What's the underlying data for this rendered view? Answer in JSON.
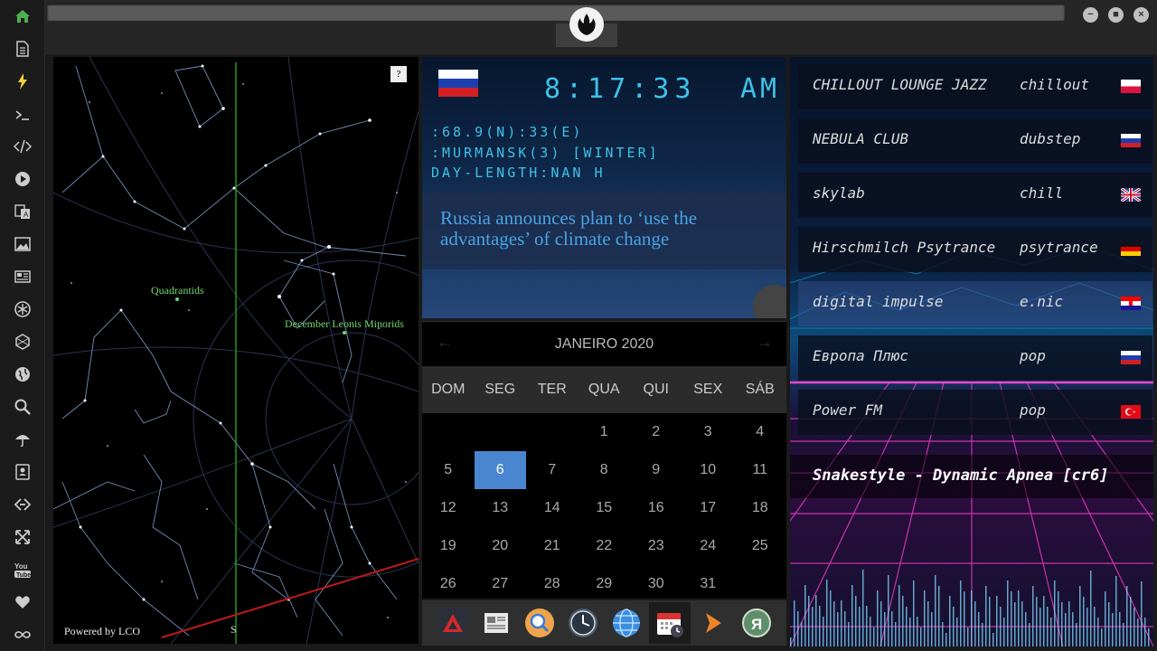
{
  "sidebar": {
    "items": [
      {
        "name": "home-icon"
      },
      {
        "name": "document-icon"
      },
      {
        "name": "lightning-icon"
      },
      {
        "name": "terminal-icon"
      },
      {
        "name": "code-icon"
      },
      {
        "name": "play-icon"
      },
      {
        "name": "translate-icon"
      },
      {
        "name": "image-icon"
      },
      {
        "name": "news-icon"
      },
      {
        "name": "rebel-alliance-icon"
      },
      {
        "name": "hexagon-icon"
      },
      {
        "name": "globe-icon"
      },
      {
        "name": "search-icon"
      },
      {
        "name": "umbrella-icon"
      },
      {
        "name": "contact-card-icon"
      },
      {
        "name": "link-icon"
      },
      {
        "name": "expand-icon"
      },
      {
        "name": "youtube-icon"
      },
      {
        "name": "heart-icon"
      },
      {
        "name": "infinity-icon"
      }
    ],
    "accent": "#4caf50"
  },
  "window": {
    "minimize": "−",
    "maximize": "■",
    "close": "×"
  },
  "skymap": {
    "help": "?",
    "powered_by": "Powered by LCO",
    "direction": "S",
    "meteors": [
      {
        "label": "Quadrantids"
      },
      {
        "label": "December Leonis Minorids"
      }
    ]
  },
  "clock": {
    "time": "8:17:33",
    "ampm": "AM",
    "coords": ":68.9(N):33(E)",
    "location": ":MURMANSK(3) [WINTER]",
    "day_length": "DAY-LENGTH:NAN H",
    "color": "#3fc1e8"
  },
  "news": {
    "headline": "Russia announces plan to ‘use the advantages’ of climate change"
  },
  "calendar": {
    "month": "JANEIRO 2020",
    "prev": "←",
    "next": "→",
    "weekdays": [
      "DOM",
      "SEG",
      "TER",
      "QUA",
      "QUI",
      "SEX",
      "SÁB"
    ],
    "weeks": [
      [
        "",
        "",
        "",
        "1",
        "2",
        "3",
        "4"
      ],
      [
        "5",
        "6",
        "7",
        "8",
        "9",
        "10",
        "11"
      ],
      [
        "12",
        "13",
        "14",
        "15",
        "16",
        "17",
        "18"
      ],
      [
        "19",
        "20",
        "21",
        "22",
        "23",
        "24",
        "25"
      ],
      [
        "26",
        "27",
        "28",
        "29",
        "30",
        "31",
        ""
      ]
    ],
    "today": "6",
    "today_color": "#4a86cf"
  },
  "dock": [
    {
      "name": "red-triangle-app-icon"
    },
    {
      "name": "newspaper-app-icon"
    },
    {
      "name": "magnifier-app-icon"
    },
    {
      "name": "clock-app-icon"
    },
    {
      "name": "globe-app-icon"
    },
    {
      "name": "calendar-app-icon"
    },
    {
      "name": "orange-arrow-app-icon"
    },
    {
      "name": "yandex-app-icon"
    }
  ],
  "radio": {
    "stations": [
      {
        "name": "CHILLOUT LOUNGE JAZZ",
        "genre": "chillout",
        "flag": "poland-flag-icon"
      },
      {
        "name": "NEBULA CLUB",
        "genre": "dubstep",
        "flag": "russia-flag-icon"
      },
      {
        "name": "skylab",
        "genre": "chill",
        "flag": "uk-flag-icon"
      },
      {
        "name": "Hirschmilch Psytrance",
        "genre": "psytrance",
        "flag": "germany-flag-icon"
      },
      {
        "name": "digital impulse",
        "genre": "e.nic",
        "flag": "croatia-flag-icon"
      },
      {
        "name": "Европа Плюс",
        "genre": "pop",
        "flag": "russia-flag-icon"
      },
      {
        "name": "Power FM",
        "genre": "pop",
        "flag": "turkey-flag-icon"
      }
    ],
    "now_playing": "Snakestyle - Dynamic Apnea [cr6]"
  }
}
